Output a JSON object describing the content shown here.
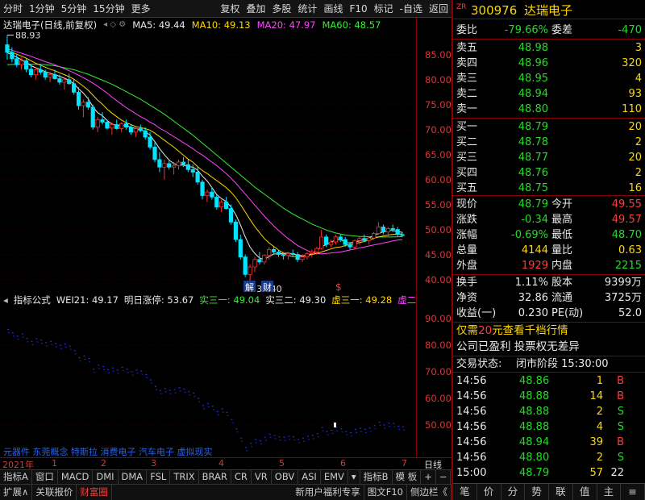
{
  "toolbar": {
    "left": [
      "分时",
      "1分钟",
      "5分钟",
      "15分钟",
      "更多"
    ],
    "right": [
      "复权",
      "叠加",
      "多股",
      "统计",
      "画线",
      "F10",
      "标记",
      "-自选",
      "返回"
    ]
  },
  "legend": {
    "title": "达瑞电子(日线,前复权)",
    "ma5": "MA5: 49.44",
    "ma10": "MA10: 49.13",
    "ma20": "MA20: 47.97",
    "ma60": "MA60: 48.57",
    "colors": {
      "ma5": "#e8e8e8",
      "ma10": "#ffd700",
      "ma20": "#ff44ff",
      "ma60": "#33ee33"
    }
  },
  "chart_data": {
    "type": "candlestick",
    "y_range": [
      37.5,
      89.5
    ],
    "y_ticks": [
      "85.00",
      "80.00",
      "75.00",
      "70.00",
      "65.00",
      "60.00",
      "55.00",
      "50.00",
      "45.00",
      "40.00"
    ],
    "y_tick_values": [
      85,
      80,
      75,
      70,
      65,
      60,
      55,
      50,
      45,
      40
    ],
    "high_label": "88.93",
    "low_label": "39.40",
    "markers": [
      "解",
      "财",
      "$"
    ],
    "candles": [
      [
        87.0,
        88.93,
        84.0,
        85.5
      ],
      [
        85.5,
        86.5,
        83.5,
        84.2
      ],
      [
        84.2,
        85.0,
        82.5,
        83.0
      ],
      [
        83.0,
        84.5,
        82.0,
        83.8
      ],
      [
        83.8,
        84.2,
        81.5,
        82.1
      ],
      [
        82.1,
        83.0,
        80.5,
        81.0
      ],
      [
        81.0,
        82.5,
        80.0,
        82.0
      ],
      [
        82.0,
        83.0,
        81.0,
        81.5
      ],
      [
        81.5,
        82.0,
        80.0,
        80.5
      ],
      [
        80.5,
        81.5,
        79.5,
        81.0
      ],
      [
        81.0,
        82.0,
        80.0,
        80.2
      ],
      [
        80.2,
        81.0,
        79.0,
        79.5
      ],
      [
        79.5,
        80.5,
        78.0,
        80.0
      ],
      [
        80.0,
        81.2,
        79.0,
        79.2
      ],
      [
        79.2,
        80.0,
        77.0,
        77.5
      ],
      [
        77.5,
        78.5,
        74.0,
        74.8
      ],
      [
        74.8,
        76.0,
        72.5,
        75.5
      ],
      [
        75.5,
        76.5,
        74.0,
        74.5
      ],
      [
        74.5,
        75.0,
        70.0,
        70.5
      ],
      [
        70.5,
        72.5,
        69.5,
        72.0
      ],
      [
        72.0,
        73.5,
        71.0,
        71.5
      ],
      [
        71.5,
        72.0,
        70.0,
        70.3
      ],
      [
        70.3,
        71.5,
        69.0,
        71.0
      ],
      [
        71.0,
        72.0,
        70.0,
        70.2
      ],
      [
        70.2,
        71.5,
        69.5,
        71.2
      ],
      [
        71.2,
        72.0,
        70.0,
        70.5
      ],
      [
        70.5,
        71.0,
        69.0,
        69.5
      ],
      [
        69.5,
        70.5,
        68.5,
        70.2
      ],
      [
        70.2,
        71.0,
        69.5,
        69.8
      ],
      [
        69.8,
        70.5,
        68.0,
        68.5
      ],
      [
        68.5,
        69.5,
        66.0,
        66.5
      ],
      [
        66.5,
        67.5,
        63.5,
        64.0
      ],
      [
        64.0,
        65.5,
        61.5,
        62.5
      ],
      [
        62.5,
        64.0,
        60.0,
        63.2
      ],
      [
        63.2,
        64.0,
        62.0,
        62.5
      ],
      [
        62.5,
        63.5,
        61.0,
        62.8
      ],
      [
        62.8,
        64.0,
        62.0,
        63.5
      ],
      [
        63.5,
        64.5,
        62.5,
        63.0
      ],
      [
        63.0,
        64.0,
        61.5,
        62.0
      ],
      [
        62.0,
        63.0,
        60.5,
        61.5
      ],
      [
        61.5,
        62.5,
        59.0,
        59.5
      ],
      [
        59.5,
        60.0,
        56.0,
        56.8
      ],
      [
        56.8,
        58.0,
        55.5,
        57.5
      ],
      [
        57.5,
        58.5,
        56.0,
        56.5
      ],
      [
        56.5,
        57.0,
        54.0,
        54.5
      ],
      [
        54.5,
        56.0,
        53.5,
        55.5
      ],
      [
        55.5,
        56.5,
        54.0,
        54.2
      ],
      [
        54.2,
        55.0,
        51.0,
        51.5
      ],
      [
        51.5,
        52.0,
        47.5,
        48.0
      ],
      [
        48.0,
        49.0,
        44.0,
        44.5
      ],
      [
        44.5,
        45.0,
        40.5,
        41.0
      ],
      [
        41.0,
        43.0,
        39.4,
        42.5
      ],
      [
        42.5,
        44.5,
        41.5,
        44.0
      ],
      [
        44.0,
        45.5,
        43.0,
        43.5
      ],
      [
        43.5,
        45.0,
        43.0,
        44.8
      ],
      [
        44.8,
        46.5,
        44.0,
        46.0
      ],
      [
        46.0,
        46.5,
        45.0,
        45.5
      ],
      [
        45.5,
        46.0,
        44.5,
        45.0
      ],
      [
        45.0,
        45.5,
        44.0,
        44.8
      ],
      [
        44.8,
        45.5,
        44.0,
        45.2
      ],
      [
        45.2,
        46.0,
        44.5,
        45.0
      ],
      [
        45.0,
        45.5,
        43.5,
        44.0
      ],
      [
        44.0,
        45.0,
        43.5,
        44.5
      ],
      [
        44.5,
        45.5,
        44.0,
        45.2
      ],
      [
        45.2,
        46.0,
        44.5,
        45.5
      ],
      [
        45.5,
        46.5,
        45.0,
        46.2
      ],
      [
        46.2,
        50.0,
        46.0,
        48.5
      ],
      [
        48.5,
        49.0,
        46.5,
        47.0
      ],
      [
        47.0,
        48.0,
        46.5,
        47.5
      ],
      [
        47.5,
        49.0,
        47.0,
        48.5
      ],
      [
        48.5,
        49.0,
        47.5,
        48.0
      ],
      [
        48.0,
        48.5,
        46.5,
        47.0
      ],
      [
        47.0,
        47.5,
        46.0,
        46.5
      ],
      [
        46.5,
        48.0,
        46.0,
        47.8
      ],
      [
        47.8,
        48.5,
        47.0,
        48.2
      ],
      [
        48.2,
        49.0,
        47.5,
        47.8
      ],
      [
        47.8,
        48.5,
        47.0,
        48.3
      ],
      [
        48.3,
        49.5,
        48.0,
        49.2
      ],
      [
        49.2,
        51.5,
        49.0,
        50.5
      ],
      [
        50.5,
        51.0,
        49.0,
        49.5
      ],
      [
        49.5,
        50.5,
        48.5,
        50.2
      ],
      [
        50.2,
        51.0,
        49.5,
        50.0
      ],
      [
        50.0,
        50.5,
        48.5,
        49.0
      ],
      [
        49.0,
        49.5,
        48.5,
        48.79
      ]
    ],
    "ma5": [
      85.4,
      85,
      84.5,
      84,
      83.5,
      82.8,
      82.4,
      82,
      81.6,
      81.3,
      81,
      80.7,
      80.3,
      79.9,
      79.2,
      78.2,
      77.3,
      76.2,
      74.6,
      73.4,
      72.8,
      71.8,
      71.1,
      70.9,
      70.8,
      70.8,
      70.5,
      70.2,
      70,
      69.6,
      68.9,
      67.6,
      66.2,
      65,
      63.9,
      63.2,
      62.9,
      62.9,
      62.6,
      62.5,
      61.9,
      60.7,
      59.7,
      58.4,
      57,
      56.2,
      55.6,
      54.5,
      53,
      50.9,
      48.5,
      46.5,
      45.2,
      44.3,
      44,
      44.6,
      45.1,
      45.1,
      45.2,
      45.3,
      45.1,
      44.9,
      44.7,
      44.8,
      45.1,
      45.9,
      46.5,
      47,
      47.5,
      47.9,
      48,
      47.4,
      47.3,
      47.5,
      47.7,
      48,
      48.3,
      48.8,
      49.2,
      49.5,
      49.8,
      49.8,
      49.6,
      49.44
    ],
    "ma10": [
      85.8,
      85.5,
      85.1,
      84.7,
      84.3,
      83.8,
      83.3,
      82.9,
      82.5,
      82.1,
      81.8,
      81.4,
      81,
      80.6,
      80.1,
      79.4,
      78.7,
      77.9,
      76.9,
      75.9,
      75.1,
      74.1,
      73.3,
      72.6,
      71.9,
      71.4,
      71,
      70.6,
      70.4,
      70.2,
      69.9,
      69.3,
      68.6,
      67.9,
      67.2,
      66.5,
      65.7,
      64.9,
      64.1,
      63.5,
      62.6,
      61.8,
      61.2,
      60.5,
      59.8,
      59.1,
      58.4,
      57.5,
      56.4,
      55,
      53.5,
      52,
      50.6,
      49.4,
      48.2,
      47.3,
      46.6,
      45.9,
      45.3,
      44.8,
      44.6,
      44.6,
      44.7,
      44.8,
      45,
      45.2,
      45.5,
      45.8,
      46.1,
      46.4,
      46.5,
      46.8,
      47,
      47.2,
      47.4,
      47.6,
      47.9,
      48.2,
      48.5,
      48.7,
      48.9,
      49,
      49.1,
      49.13
    ],
    "ma20": [
      86.2,
      85.9,
      85.6,
      85.3,
      85,
      84.7,
      84.3,
      84,
      83.6,
      83.3,
      83,
      82.6,
      82.2,
      81.8,
      81.4,
      80.9,
      80.4,
      79.9,
      79.3,
      78.7,
      78,
      77.3,
      76.5,
      75.8,
      75.1,
      74.4,
      73.8,
      73.2,
      72.6,
      72.1,
      71.5,
      71,
      70.3,
      69.8,
      69.2,
      68.6,
      68,
      67.4,
      66.8,
      66.2,
      65.5,
      64.9,
      64.2,
      63.5,
      62.8,
      62,
      61.2,
      60.3,
      59.3,
      58.2,
      57.1,
      56,
      54.9,
      53.8,
      52.7,
      51.7,
      50.7,
      49.8,
      49,
      48.2,
      47.5,
      46.8,
      46.3,
      45.8,
      45.4,
      45.2,
      45.1,
      45.2,
      45.3,
      45.4,
      45.5,
      45.7,
      45.9,
      46.1,
      46.3,
      46.5,
      46.7,
      46.9,
      47.1,
      47.3,
      47.5,
      47.7,
      47.9,
      47.97
    ],
    "ma60": [
      83,
      83.05,
      83.1,
      83.15,
      83.15,
      83.1,
      83.1,
      83.1,
      83,
      82.9,
      82.8,
      82.6,
      82.4,
      82.2,
      82,
      81.7,
      81.4,
      81.1,
      80.7,
      80.3,
      79.9,
      79.5,
      79.1,
      78.6,
      78.1,
      77.6,
      77.1,
      76.6,
      76.1,
      75.5,
      74.9,
      74.3,
      73.7,
      73.1,
      72.4,
      71.7,
      71,
      70.3,
      69.6,
      68.9,
      68.1,
      67.3,
      66.5,
      65.7,
      64.9,
      64.1,
      63.3,
      62.5,
      61.7,
      60.9,
      60.1,
      59.3,
      58.5,
      57.8,
      57.1,
      56.4,
      55.7,
      55,
      54.3,
      53.7,
      53.1,
      52.6,
      52.1,
      51.6,
      51.1,
      50.7,
      50.3,
      49.9,
      49.6,
      49.3,
      49.1,
      48.9,
      48.8,
      48.7,
      48.6,
      48.6,
      48.55,
      48.5,
      48.5,
      48.5,
      48.5,
      48.5,
      48.55,
      48.57
    ]
  },
  "indicator": {
    "name": "指标公式",
    "wei": "WEI21: 49.17",
    "next": "明日涨停: 53.67",
    "s1": "实三一: 49.04",
    "s2": "实三二: 49.30",
    "x1": "虚三一: 49.28",
    "x2": "虚二一",
    "y_ticks": [
      "90.00",
      "80.00",
      "70.00",
      "60.00",
      "50.00"
    ],
    "y_tick_values": [
      90,
      80,
      70,
      60,
      50
    ],
    "y_range": [
      38,
      94
    ],
    "concepts": "元器件 东莞概念 特斯拉 消费电子 汽车电子 虚拟现实"
  },
  "timeaxis": {
    "year": "2021年",
    "months": [
      "1",
      "2",
      "3",
      "4",
      "5",
      "6",
      "7"
    ],
    "right": "日线"
  },
  "tabs1": [
    "指标A",
    "窗口",
    "MACD",
    "DMI",
    "DMA",
    "FSL",
    "TRIX",
    "BRAR",
    "CR",
    "VR",
    "OBV",
    "ASI",
    "EMV",
    "▾",
    "指标B",
    "模 板",
    "+",
    "−"
  ],
  "tabs2": [
    "扩展∧",
    "关联报价",
    "财富圈",
    "新用户福利专享",
    "图文F10",
    "侧边栏《"
  ],
  "stock": {
    "code": "300976",
    "name": "达瑞电子",
    "tag": "ZR"
  },
  "orderbook": {
    "weibi_label": "委比",
    "weibi": "-79.66%",
    "weicha_label": "委差",
    "weicha": "-470",
    "asks": [
      {
        "label": "卖五",
        "price": "48.98",
        "vol": "3"
      },
      {
        "label": "卖四",
        "price": "48.96",
        "vol": "320"
      },
      {
        "label": "卖三",
        "price": "48.95",
        "vol": "4"
      },
      {
        "label": "卖二",
        "price": "48.94",
        "vol": "93"
      },
      {
        "label": "卖一",
        "price": "48.80",
        "vol": "110"
      }
    ],
    "bids": [
      {
        "label": "买一",
        "price": "48.79",
        "vol": "20"
      },
      {
        "label": "买二",
        "price": "48.78",
        "vol": "2"
      },
      {
        "label": "买三",
        "price": "48.77",
        "vol": "20"
      },
      {
        "label": "买四",
        "price": "48.76",
        "vol": "2"
      },
      {
        "label": "买五",
        "price": "48.75",
        "vol": "16"
      }
    ]
  },
  "quote": [
    {
      "l1": "现价",
      "v1": "48.79",
      "c1": "green",
      "l2": "今开",
      "v2": "49.55",
      "c2": "red"
    },
    {
      "l1": "涨跌",
      "v1": "-0.34",
      "c1": "green",
      "l2": "最高",
      "v2": "49.57",
      "c2": "red"
    },
    {
      "l1": "涨幅",
      "v1": "-0.69%",
      "c1": "green",
      "l2": "最低",
      "v2": "48.70",
      "c2": "green"
    },
    {
      "l1": "总量",
      "v1": "4144",
      "c1": "yellow",
      "l2": "量比",
      "v2": "0.63",
      "c2": "yellow"
    },
    {
      "l1": "外盘",
      "v1": "1929",
      "c1": "red",
      "l2": "内盘",
      "v2": "2215",
      "c2": "green"
    }
  ],
  "fund": [
    {
      "l1": "换手",
      "v1": "1.11%",
      "l2": "股本",
      "v2": "9399万"
    },
    {
      "l1": "净资",
      "v1": "32.86",
      "l2": "流通",
      "v2": "3725万"
    },
    {
      "l1": "收益(一)",
      "v1": "0.230",
      "l2": "PE(动)",
      "v2": "52.0"
    }
  ],
  "promo": {
    "line1a": "仅需",
    "line1b": "20",
    "line1c": "元查看千档行情",
    "line2": "公司已盈利 投票权无差异"
  },
  "status": {
    "label": "交易状态:",
    "value": "闭市阶段 15:30:00"
  },
  "ticks": [
    {
      "t": "14:56",
      "p": "48.86",
      "v": "1",
      "s": "B"
    },
    {
      "t": "14:56",
      "p": "48.88",
      "v": "14",
      "s": "B"
    },
    {
      "t": "14:56",
      "p": "48.88",
      "v": "2",
      "s": "S"
    },
    {
      "t": "14:56",
      "p": "48.88",
      "v": "4",
      "s": "S"
    },
    {
      "t": "14:56",
      "p": "48.94",
      "v": "39",
      "s": "B"
    },
    {
      "t": "14:56",
      "p": "48.80",
      "v": "2",
      "s": "S"
    },
    {
      "t": "15:00",
      "p": "48.79",
      "v": "57",
      "s": "22"
    }
  ],
  "bottomnav": [
    "笔",
    "价",
    "分",
    "势",
    "联",
    "值",
    "主",
    "≡"
  ]
}
